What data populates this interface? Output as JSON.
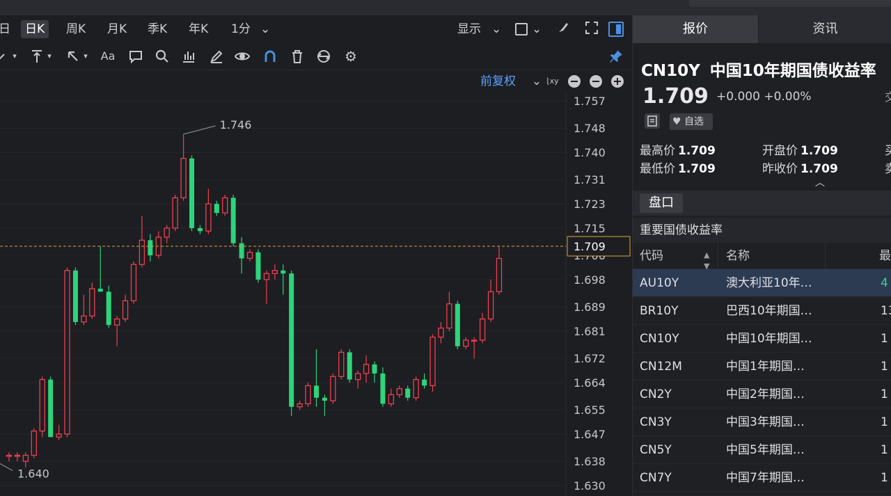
{
  "toolbar": {
    "periods": [
      "日",
      "日K",
      "周K",
      "月K",
      "季K",
      "年K",
      "1分"
    ],
    "active_period": "日K",
    "display_label": "显示",
    "adjust_label": "前复权"
  },
  "chart_data": {
    "type": "candlestick",
    "y_ticks": [
      "1.757",
      "1.748",
      "1.740",
      "1.731",
      "1.723",
      "1.715",
      "1.706",
      "1.698",
      "1.689",
      "1.681",
      "1.672",
      "1.664",
      "1.655",
      "1.647",
      "1.638",
      "1.630"
    ],
    "ylim": [
      1.63,
      1.757
    ],
    "current_price_label": "1.709",
    "high_annotation": "1.746",
    "low_annotation": "1.640",
    "colors": {
      "up": "#f0404f",
      "down": "#2ed47a",
      "current_line": "#e8a33a"
    },
    "candles": [
      {
        "o": 1.64,
        "h": 1.641,
        "l": 1.638,
        "c": 1.64
      },
      {
        "o": 1.64,
        "h": 1.641,
        "l": 1.638,
        "c": 1.64
      },
      {
        "o": 1.638,
        "h": 1.641,
        "l": 1.636,
        "c": 1.64
      },
      {
        "o": 1.64,
        "h": 1.649,
        "l": 1.639,
        "c": 1.648
      },
      {
        "o": 1.648,
        "h": 1.666,
        "l": 1.646,
        "c": 1.665
      },
      {
        "o": 1.665,
        "h": 1.666,
        "l": 1.646,
        "c": 1.646
      },
      {
        "o": 1.646,
        "h": 1.65,
        "l": 1.645,
        "c": 1.647
      },
      {
        "o": 1.647,
        "h": 1.702,
        "l": 1.646,
        "c": 1.701
      },
      {
        "o": 1.701,
        "h": 1.702,
        "l": 1.683,
        "c": 1.684
      },
      {
        "o": 1.684,
        "h": 1.693,
        "l": 1.683,
        "c": 1.686
      },
      {
        "o": 1.686,
        "h": 1.697,
        "l": 1.685,
        "c": 1.695
      },
      {
        "o": 1.695,
        "h": 1.709,
        "l": 1.694,
        "c": 1.694
      },
      {
        "o": 1.694,
        "h": 1.696,
        "l": 1.682,
        "c": 1.683
      },
      {
        "o": 1.683,
        "h": 1.686,
        "l": 1.676,
        "c": 1.685
      },
      {
        "o": 1.685,
        "h": 1.693,
        "l": 1.684,
        "c": 1.691
      },
      {
        "o": 1.691,
        "h": 1.704,
        "l": 1.69,
        "c": 1.703
      },
      {
        "o": 1.703,
        "h": 1.719,
        "l": 1.702,
        "c": 1.711
      },
      {
        "o": 1.711,
        "h": 1.713,
        "l": 1.704,
        "c": 1.706
      },
      {
        "o": 1.706,
        "h": 1.714,
        "l": 1.705,
        "c": 1.712
      },
      {
        "o": 1.712,
        "h": 1.716,
        "l": 1.71,
        "c": 1.715
      },
      {
        "o": 1.715,
        "h": 1.726,
        "l": 1.714,
        "c": 1.725
      },
      {
        "o": 1.725,
        "h": 1.746,
        "l": 1.724,
        "c": 1.738
      },
      {
        "o": 1.738,
        "h": 1.739,
        "l": 1.714,
        "c": 1.715
      },
      {
        "o": 1.715,
        "h": 1.716,
        "l": 1.713,
        "c": 1.714
      },
      {
        "o": 1.714,
        "h": 1.728,
        "l": 1.713,
        "c": 1.723
      },
      {
        "o": 1.723,
        "h": 1.724,
        "l": 1.719,
        "c": 1.72
      },
      {
        "o": 1.72,
        "h": 1.726,
        "l": 1.719,
        "c": 1.725
      },
      {
        "o": 1.725,
        "h": 1.726,
        "l": 1.709,
        "c": 1.71
      },
      {
        "o": 1.71,
        "h": 1.712,
        "l": 1.7,
        "c": 1.705
      },
      {
        "o": 1.705,
        "h": 1.708,
        "l": 1.704,
        "c": 1.707
      },
      {
        "o": 1.707,
        "h": 1.708,
        "l": 1.697,
        "c": 1.698
      },
      {
        "o": 1.698,
        "h": 1.701,
        "l": 1.69,
        "c": 1.7
      },
      {
        "o": 1.7,
        "h": 1.703,
        "l": 1.698,
        "c": 1.701
      },
      {
        "o": 1.701,
        "h": 1.703,
        "l": 1.693,
        "c": 1.7
      },
      {
        "o": 1.7,
        "h": 1.701,
        "l": 1.653,
        "c": 1.656
      },
      {
        "o": 1.656,
        "h": 1.658,
        "l": 1.655,
        "c": 1.657
      },
      {
        "o": 1.657,
        "h": 1.664,
        "l": 1.656,
        "c": 1.663
      },
      {
        "o": 1.663,
        "h": 1.675,
        "l": 1.656,
        "c": 1.659
      },
      {
        "o": 1.659,
        "h": 1.66,
        "l": 1.653,
        "c": 1.658
      },
      {
        "o": 1.658,
        "h": 1.667,
        "l": 1.657,
        "c": 1.666
      },
      {
        "o": 1.666,
        "h": 1.675,
        "l": 1.665,
        "c": 1.674
      },
      {
        "o": 1.674,
        "h": 1.675,
        "l": 1.664,
        "c": 1.665
      },
      {
        "o": 1.665,
        "h": 1.668,
        "l": 1.662,
        "c": 1.667
      },
      {
        "o": 1.667,
        "h": 1.673,
        "l": 1.664,
        "c": 1.67
      },
      {
        "o": 1.67,
        "h": 1.671,
        "l": 1.664,
        "c": 1.667
      },
      {
        "o": 1.667,
        "h": 1.669,
        "l": 1.656,
        "c": 1.657
      },
      {
        "o": 1.657,
        "h": 1.662,
        "l": 1.656,
        "c": 1.66
      },
      {
        "o": 1.66,
        "h": 1.663,
        "l": 1.659,
        "c": 1.662
      },
      {
        "o": 1.662,
        "h": 1.663,
        "l": 1.658,
        "c": 1.659
      },
      {
        "o": 1.659,
        "h": 1.666,
        "l": 1.658,
        "c": 1.665
      },
      {
        "o": 1.665,
        "h": 1.667,
        "l": 1.662,
        "c": 1.663
      },
      {
        "o": 1.663,
        "h": 1.68,
        "l": 1.661,
        "c": 1.679
      },
      {
        "o": 1.679,
        "h": 1.684,
        "l": 1.677,
        "c": 1.682
      },
      {
        "o": 1.682,
        "h": 1.694,
        "l": 1.681,
        "c": 1.69
      },
      {
        "o": 1.69,
        "h": 1.691,
        "l": 1.675,
        "c": 1.676
      },
      {
        "o": 1.676,
        "h": 1.679,
        "l": 1.675,
        "c": 1.678
      },
      {
        "o": 1.678,
        "h": 1.679,
        "l": 1.672,
        "c": 1.678
      },
      {
        "o": 1.678,
        "h": 1.687,
        "l": 1.677,
        "c": 1.685
      },
      {
        "o": 1.685,
        "h": 1.698,
        "l": 1.684,
        "c": 1.694
      },
      {
        "o": 1.694,
        "h": 1.709,
        "l": 1.693,
        "c": 1.705
      }
    ]
  },
  "right": {
    "tabs": [
      "报价",
      "资讯"
    ],
    "symbol_code": "CN10Y",
    "symbol_name": "中国10年期国债收益率",
    "price": "1.709",
    "change": "+0.000",
    "change_pct": "+0.00%",
    "exch_cut": "交",
    "fav_label": "自选",
    "stats": {
      "high_label": "最高价",
      "high": "1.709",
      "open_label": "开盘价",
      "open": "1.709",
      "low_label": "最低价",
      "low": "1.709",
      "prev_label": "昨收价",
      "prev": "1.709",
      "cut1": "买",
      "cut2": "卖"
    },
    "pankou": "盘口",
    "section_title": "重要国债收益率",
    "table": {
      "col_code": "代码",
      "col_name": "名称",
      "col_val": "最",
      "rows": [
        {
          "code": "AU10Y",
          "name": "澳大利亚10年…",
          "val": "4"
        },
        {
          "code": "BR10Y",
          "name": "巴西10年期国…",
          "val": "13"
        },
        {
          "code": "CN10Y",
          "name": "中国10年期国…",
          "val": "1"
        },
        {
          "code": "CN12M",
          "name": "中国1年期国…",
          "val": "1"
        },
        {
          "code": "CN2Y",
          "name": "中国2年期国…",
          "val": "1"
        },
        {
          "code": "CN3Y",
          "name": "中国3年期国…",
          "val": "1"
        },
        {
          "code": "CN5Y",
          "name": "中国5年期国…",
          "val": "1"
        },
        {
          "code": "CN7Y",
          "name": "中国7年期国…",
          "val": "1"
        }
      ]
    }
  }
}
